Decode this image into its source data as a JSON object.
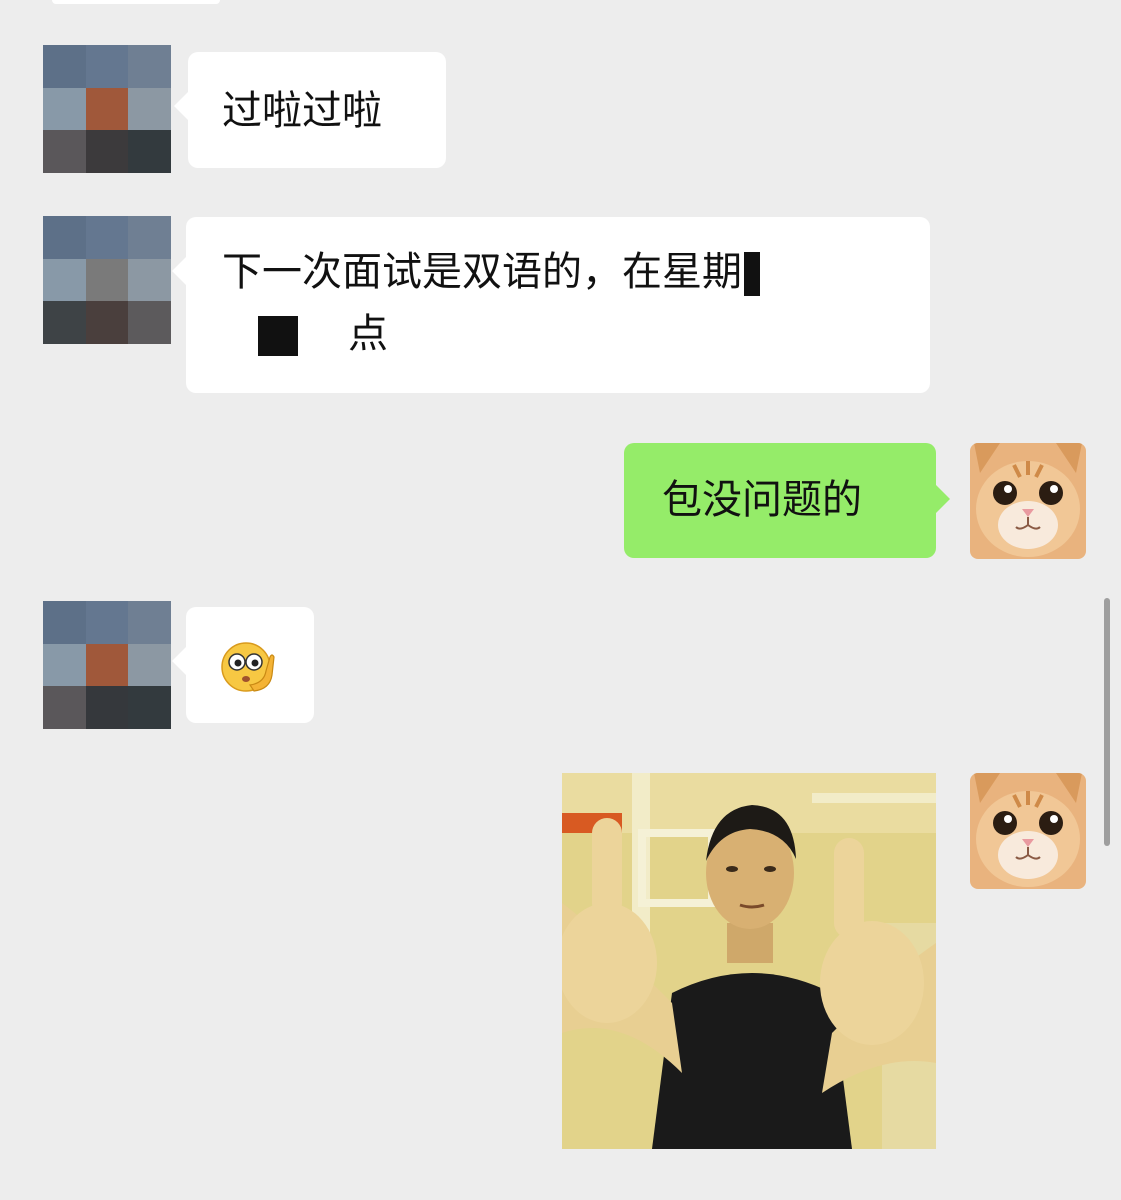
{
  "messages": [
    {
      "side": "left",
      "text": "过啦过啦"
    },
    {
      "side": "left",
      "text_line1": "下一次面试是双语的，在星期",
      "text_line2_suffix": "点"
    },
    {
      "side": "right",
      "text": "包没问题的"
    },
    {
      "side": "left",
      "emoji": "thinking-face-emoji"
    },
    {
      "side": "right",
      "image": "thumbs-up-photo"
    }
  ],
  "icons": {
    "contact_avatar": "pixelated-avatar",
    "self_avatar": "cat-avatar"
  },
  "colors": {
    "background": "#ededed",
    "incoming_bubble": "#ffffff",
    "outgoing_bubble": "#95ec69"
  }
}
